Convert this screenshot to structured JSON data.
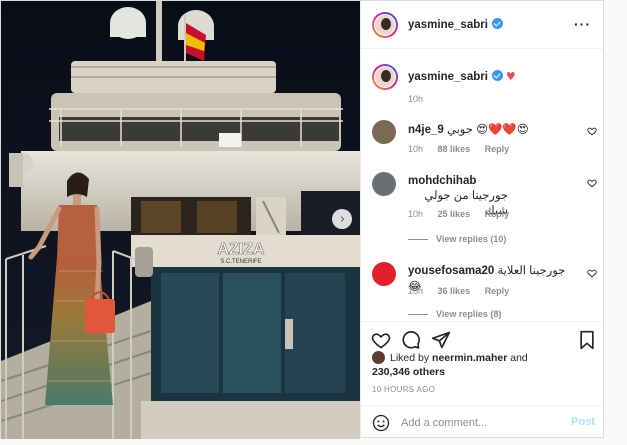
{
  "post": {
    "username": "yasmine_sabri",
    "yacht_name": "AZIZA",
    "yacht_port": "S.C.TENERIFE"
  },
  "caption": {
    "username": "yasmine_sabri",
    "time": "10h"
  },
  "comments": [
    {
      "username": "n4je_9",
      "text": "جوبي",
      "emojis": "😍❤️❤️😍",
      "time": "10h",
      "likes": "88 likes",
      "reply": "Reply",
      "avatar_color": "#7a6a54"
    },
    {
      "username": "mohdchihab",
      "text": "جورجينا من جولي شيك",
      "emojis": "",
      "time": "10h",
      "likes": "25 likes",
      "reply": "Reply",
      "view_replies": "View replies (10)",
      "avatar_color": "#6b6f74"
    },
    {
      "username": "yousefosama20",
      "text": "جورجينا العلاية",
      "emojis": "😂",
      "time": "10h",
      "likes": "36 likes",
      "reply": "Reply",
      "view_replies": "View replies (8)",
      "avatar_color": "#e0202a"
    }
  ],
  "actions": {
    "like": "heart-icon",
    "comment": "comment-icon",
    "share": "send-icon",
    "save": "bookmark-icon"
  },
  "likes": {
    "prefix": "Liked by",
    "user": "neermin.maher",
    "and": "and",
    "others": "230,346 others"
  },
  "timestamp": "10 HOURS AGO",
  "add_comment": {
    "placeholder": "Add a comment...",
    "post_label": "Post"
  },
  "colors": {
    "verified": "#3897f0",
    "heart": "#ed4956",
    "post_disabled": "#b2dffc",
    "muted": "#8e8e8e"
  }
}
